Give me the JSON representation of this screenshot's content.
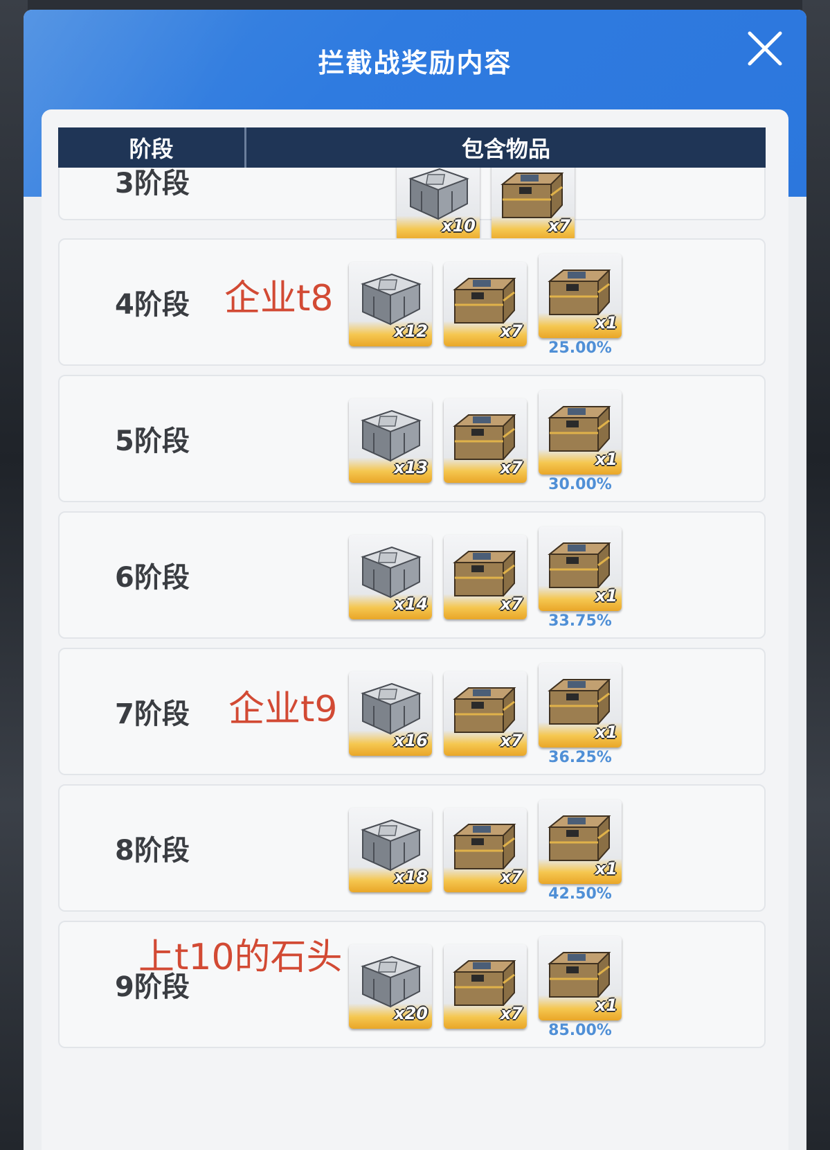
{
  "modal": {
    "title": "拦截战奖励内容",
    "close_icon": "close-icon"
  },
  "table": {
    "col_stage": "阶段",
    "col_items": "包含物品"
  },
  "rows": [
    {
      "stage": "3阶段",
      "annotation": "",
      "items": [
        {
          "type": "silver-crate",
          "qty": "x10",
          "chance": ""
        },
        {
          "type": "brown-crate",
          "qty": "x7",
          "chance": ""
        }
      ]
    },
    {
      "stage": "4阶段",
      "annotation": "企业t8",
      "items": [
        {
          "type": "silver-crate",
          "qty": "x12",
          "chance": ""
        },
        {
          "type": "brown-crate",
          "qty": "x7",
          "chance": ""
        },
        {
          "type": "brown-crate",
          "qty": "x1",
          "chance": "25.00%"
        }
      ]
    },
    {
      "stage": "5阶段",
      "annotation": "",
      "items": [
        {
          "type": "silver-crate",
          "qty": "x13",
          "chance": ""
        },
        {
          "type": "brown-crate",
          "qty": "x7",
          "chance": ""
        },
        {
          "type": "brown-crate",
          "qty": "x1",
          "chance": "30.00%"
        }
      ]
    },
    {
      "stage": "6阶段",
      "annotation": "",
      "items": [
        {
          "type": "silver-crate",
          "qty": "x14",
          "chance": ""
        },
        {
          "type": "brown-crate",
          "qty": "x7",
          "chance": ""
        },
        {
          "type": "brown-crate",
          "qty": "x1",
          "chance": "33.75%"
        }
      ]
    },
    {
      "stage": "7阶段",
      "annotation": "企业t9",
      "items": [
        {
          "type": "silver-crate",
          "qty": "x16",
          "chance": ""
        },
        {
          "type": "brown-crate",
          "qty": "x7",
          "chance": ""
        },
        {
          "type": "brown-crate",
          "qty": "x1",
          "chance": "36.25%"
        }
      ]
    },
    {
      "stage": "8阶段",
      "annotation": "",
      "items": [
        {
          "type": "silver-crate",
          "qty": "x18",
          "chance": ""
        },
        {
          "type": "brown-crate",
          "qty": "x7",
          "chance": ""
        },
        {
          "type": "brown-crate",
          "qty": "x1",
          "chance": "42.50%"
        }
      ]
    },
    {
      "stage": "9阶段",
      "annotation": "上t10的石头",
      "items": [
        {
          "type": "silver-crate",
          "qty": "x20",
          "chance": ""
        },
        {
          "type": "brown-crate",
          "qty": "x7",
          "chance": ""
        },
        {
          "type": "brown-crate",
          "qty": "x1",
          "chance": "85.00%"
        }
      ]
    }
  ],
  "colors": {
    "header_blue": "#2f7be0",
    "table_header": "#1f3556",
    "annotation_red": "#d24a34",
    "chance_blue": "#4f8fd6"
  }
}
